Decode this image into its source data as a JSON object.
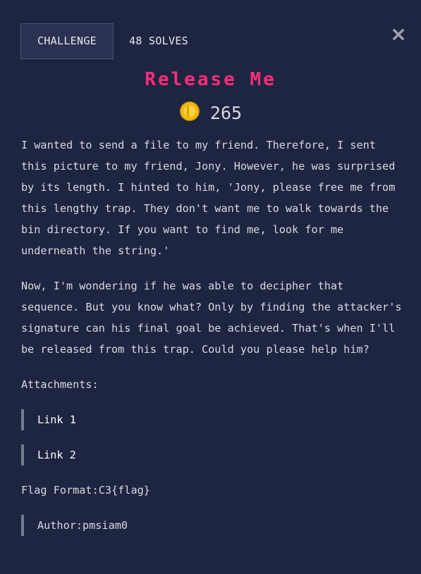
{
  "tabs": {
    "challenge_label": "CHALLENGE",
    "solves_label": "48 SOLVES"
  },
  "close_icon": "close-icon",
  "title": "Release Me",
  "points": {
    "icon": "coin-icon",
    "value": "265"
  },
  "description": {
    "p1": "I wanted to send a file to my friend. Therefore, I sent this picture to my friend, Jony. However, he was surprised by its length. I hinted to him, 'Jony, please free me from this lengthy trap. They don't want me to walk towards the bin directory. If you want to find me, look for me underneath the string.'",
    "p2": "Now, I'm wondering if he was able to decipher that sequence. But you know what? Only by finding the attacker's signature can his final goal be achieved. That's when I'll be released from this trap. Could you please help him?"
  },
  "attachments": {
    "label": "Attachments:",
    "links": [
      "Link 1",
      "Link 2"
    ]
  },
  "flag_format": "Flag Format:C3{flag}",
  "author": "Author:pmsiam0",
  "colors": {
    "background": "#1e2540",
    "title": "#ff2d7a",
    "text": "#d7dae3",
    "coin": "#f2b705"
  }
}
